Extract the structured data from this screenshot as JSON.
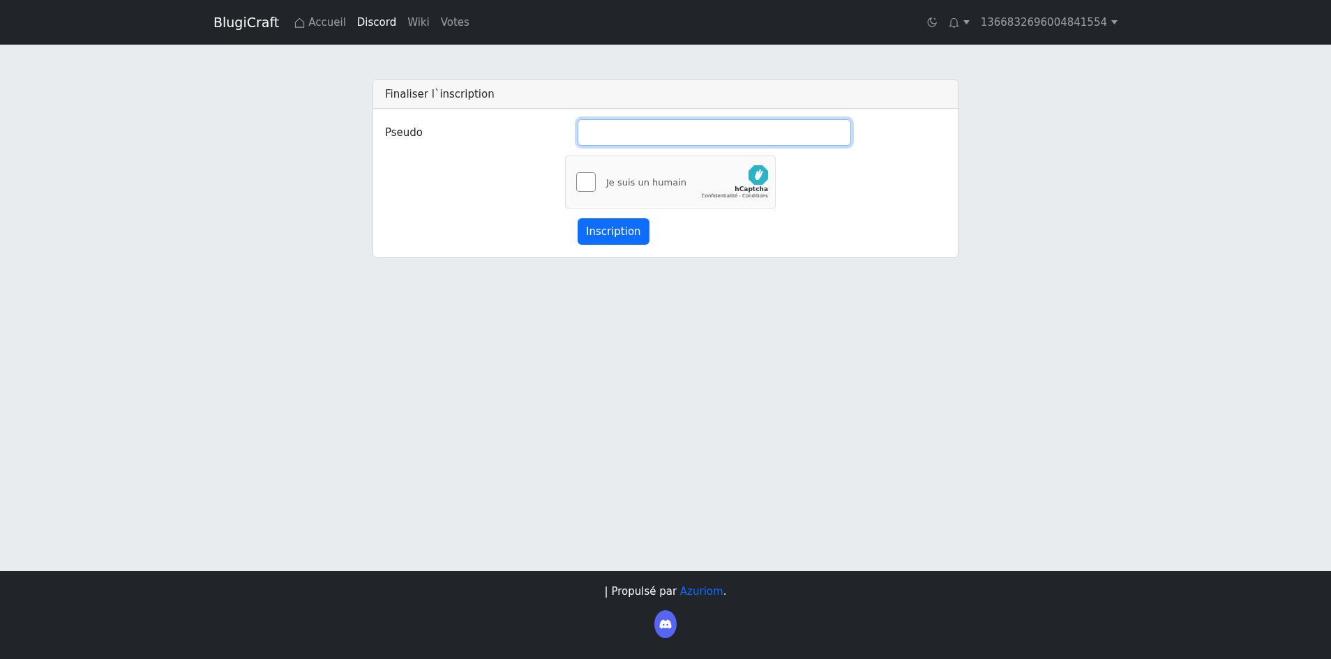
{
  "navbar": {
    "brand": "BlugiCraft",
    "links": [
      {
        "label": "Accueil",
        "kind": "icon_link",
        "selected": false
      },
      {
        "label": "Discord",
        "kind": "link",
        "selected": true
      },
      {
        "label": "Wiki",
        "kind": "link",
        "selected": false
      },
      {
        "label": "Votes",
        "kind": "link",
        "selected": false
      }
    ],
    "user": "1366832696004841554"
  },
  "card": {
    "title": "Finaliser l`inscription",
    "field_label": "Pseudo",
    "captcha": {
      "label": "Je suis un humain",
      "checked": false,
      "brand": "hCaptcha",
      "links": "Confidentialité - Conditions"
    },
    "submit": "Inscription"
  },
  "footer": {
    "text": "| Propulsé par ",
    "link": "Azuriom",
    "after": "."
  }
}
